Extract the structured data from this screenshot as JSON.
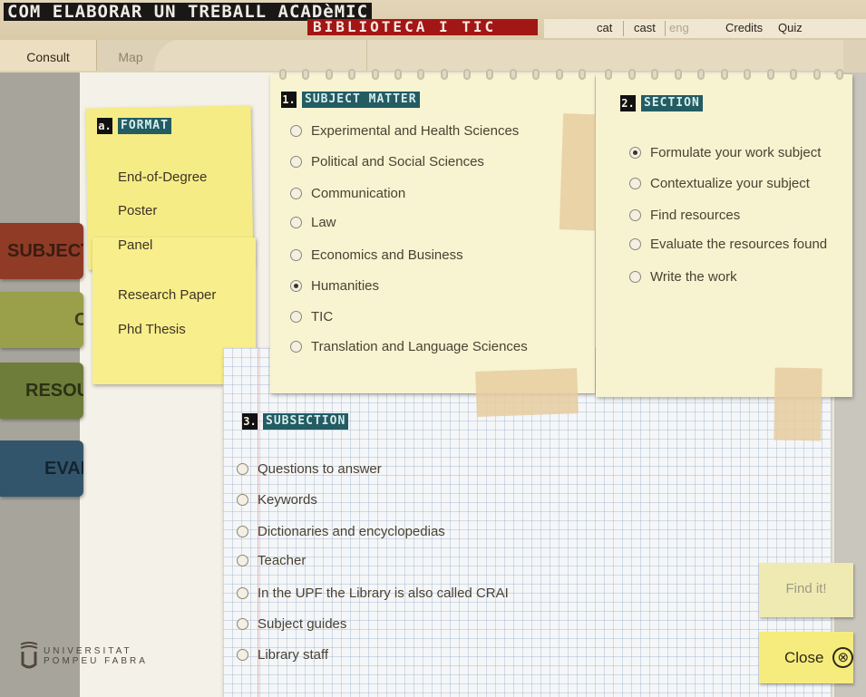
{
  "header": {
    "title": "COM ELABORAR UN TREBALL ACADèMIC",
    "subtitle": "BIBLIOTECA I TIC",
    "languages": [
      "cat",
      "cast",
      "eng"
    ],
    "credits": "Credits",
    "quiz": "Quiz"
  },
  "tabs": {
    "consult": "Consult",
    "map": "Map"
  },
  "side_tags": [
    {
      "label": "SUBJECT",
      "color": "#8f3b26",
      "text_color": "#3a1c12"
    },
    {
      "label": "C",
      "color": "#9aa04a",
      "text_color": "#3d3f1a"
    },
    {
      "label": "RESOU",
      "color": "#6f7d3a",
      "text_color": "#2b3114"
    },
    {
      "label": "EVAL",
      "color": "#33556b",
      "text_color": "#132430"
    }
  ],
  "format": {
    "num": "a.",
    "title": "FORMAT",
    "items": [
      "End-of-Degree",
      "Poster",
      "Panel",
      "Research Paper",
      "Phd Thesis"
    ]
  },
  "subject": {
    "num": "1.",
    "title": "SUBJECT MATTER",
    "options": [
      {
        "label": "Experimental and Health Sciences",
        "selected": false
      },
      {
        "label": "Political and Social Sciences",
        "selected": false
      },
      {
        "label": "Communication",
        "selected": false
      },
      {
        "label": "Law",
        "selected": false
      },
      {
        "label": "Economics and Business",
        "selected": false
      },
      {
        "label": "Humanities",
        "selected": true
      },
      {
        "label": "TIC",
        "selected": false
      },
      {
        "label": "Translation and Language Sciences",
        "selected": false
      }
    ]
  },
  "section": {
    "num": "2.",
    "title": "SECTION",
    "options": [
      {
        "label": "Formulate your work subject",
        "selected": true
      },
      {
        "label": "Contextualize your subject",
        "selected": false
      },
      {
        "label": "Find resources",
        "selected": false
      },
      {
        "label": "Evaluate the resources found",
        "selected": false
      },
      {
        "label": "Write the work",
        "selected": false
      }
    ]
  },
  "subsection": {
    "num": "3.",
    "title": "SUBSECTION",
    "options": [
      {
        "label": "Questions to answer",
        "selected": false
      },
      {
        "label": "Keywords",
        "selected": false
      },
      {
        "label": "Dictionaries and encyclopedias",
        "selected": false
      },
      {
        "label": "Teacher",
        "selected": false
      },
      {
        "label": "In the UPF the Library is also called CRAI",
        "selected": false
      },
      {
        "label": "Subject guides",
        "selected": false
      },
      {
        "label": "Library staff",
        "selected": false
      }
    ]
  },
  "buttons": {
    "find": "Find it!",
    "close": "Close",
    "close_icon": "⊗"
  },
  "logo": {
    "line1": "UNIVERSITAT",
    "line2": "POMPEU FABRA"
  },
  "colors": {
    "accent_red": "#a31616",
    "heading_teal": "#235c63",
    "sticky_yellow": "#f6ec86"
  }
}
